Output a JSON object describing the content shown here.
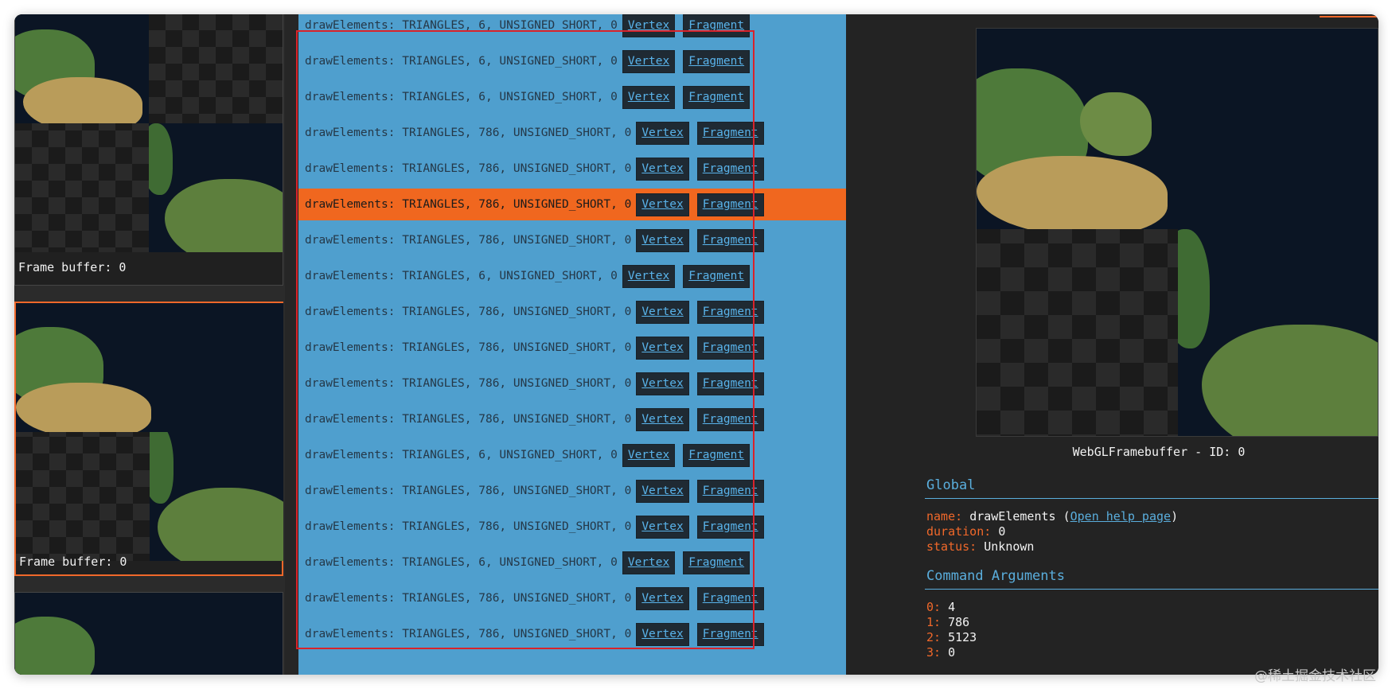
{
  "frames": [
    {
      "label": "Frame buffer: 0",
      "selected": false
    },
    {
      "label": "Frame buffer: 0",
      "selected": true
    },
    {
      "label": "",
      "selected": false
    }
  ],
  "commands": [
    {
      "text": "drawElements: TRIANGLES, 6, UNSIGNED_SHORT, 0",
      "vertex": "Vertex",
      "fragment": "Fragment",
      "active": false
    },
    {
      "text": "drawElements: TRIANGLES, 6, UNSIGNED_SHORT, 0",
      "vertex": "Vertex",
      "fragment": "Fragment",
      "active": false
    },
    {
      "text": "drawElements: TRIANGLES, 6, UNSIGNED_SHORT, 0",
      "vertex": "Vertex",
      "fragment": "Fragment",
      "active": false
    },
    {
      "text": "drawElements: TRIANGLES, 786, UNSIGNED_SHORT, 0",
      "vertex": "Vertex",
      "fragment": "Fragment",
      "active": false
    },
    {
      "text": "drawElements: TRIANGLES, 786, UNSIGNED_SHORT, 0",
      "vertex": "Vertex",
      "fragment": "Fragment",
      "active": false
    },
    {
      "text": "drawElements: TRIANGLES, 786, UNSIGNED_SHORT, 0",
      "vertex": "Vertex",
      "fragment": "Fragment",
      "active": true
    },
    {
      "text": "drawElements: TRIANGLES, 786, UNSIGNED_SHORT, 0",
      "vertex": "Vertex",
      "fragment": "Fragment",
      "active": false
    },
    {
      "text": "drawElements: TRIANGLES, 6, UNSIGNED_SHORT, 0",
      "vertex": "Vertex",
      "fragment": "Fragment",
      "active": false
    },
    {
      "text": "drawElements: TRIANGLES, 786, UNSIGNED_SHORT, 0",
      "vertex": "Vertex",
      "fragment": "Fragment",
      "active": false
    },
    {
      "text": "drawElements: TRIANGLES, 786, UNSIGNED_SHORT, 0",
      "vertex": "Vertex",
      "fragment": "Fragment",
      "active": false
    },
    {
      "text": "drawElements: TRIANGLES, 786, UNSIGNED_SHORT, 0",
      "vertex": "Vertex",
      "fragment": "Fragment",
      "active": false
    },
    {
      "text": "drawElements: TRIANGLES, 786, UNSIGNED_SHORT, 0",
      "vertex": "Vertex",
      "fragment": "Fragment",
      "active": false
    },
    {
      "text": "drawElements: TRIANGLES, 6, UNSIGNED_SHORT, 0",
      "vertex": "Vertex",
      "fragment": "Fragment",
      "active": false
    },
    {
      "text": "drawElements: TRIANGLES, 786, UNSIGNED_SHORT, 0",
      "vertex": "Vertex",
      "fragment": "Fragment",
      "active": false
    },
    {
      "text": "drawElements: TRIANGLES, 786, UNSIGNED_SHORT, 0",
      "vertex": "Vertex",
      "fragment": "Fragment",
      "active": false
    },
    {
      "text": "drawElements: TRIANGLES, 6, UNSIGNED_SHORT, 0",
      "vertex": "Vertex",
      "fragment": "Fragment",
      "active": false
    },
    {
      "text": "drawElements: TRIANGLES, 786, UNSIGNED_SHORT, 0",
      "vertex": "Vertex",
      "fragment": "Fragment",
      "active": false
    },
    {
      "text": "drawElements: TRIANGLES, 786, UNSIGNED_SHORT, 0",
      "vertex": "Vertex",
      "fragment": "Fragment",
      "active": false
    }
  ],
  "preview": {
    "caption": "WebGLFramebuffer - ID: 0"
  },
  "global": {
    "title": "Global",
    "name_key": "name:",
    "name_value": "drawElements",
    "help_link": "Open help page",
    "duration_key": "duration:",
    "duration_value": "0",
    "status_key": "status:",
    "status_value": "Unknown"
  },
  "arguments": {
    "title": "Command Arguments",
    "items": [
      {
        "key": "0:",
        "value": "4"
      },
      {
        "key": "1:",
        "value": "786"
      },
      {
        "key": "2:",
        "value": "5123"
      },
      {
        "key": "3:",
        "value": "0"
      }
    ]
  },
  "watermark": "@稀土掘金技术社区",
  "colors": {
    "accent": "#f0682a",
    "list_bg": "#4f9fce",
    "link": "#5aaedd",
    "highlight_box": "#d9232b"
  }
}
